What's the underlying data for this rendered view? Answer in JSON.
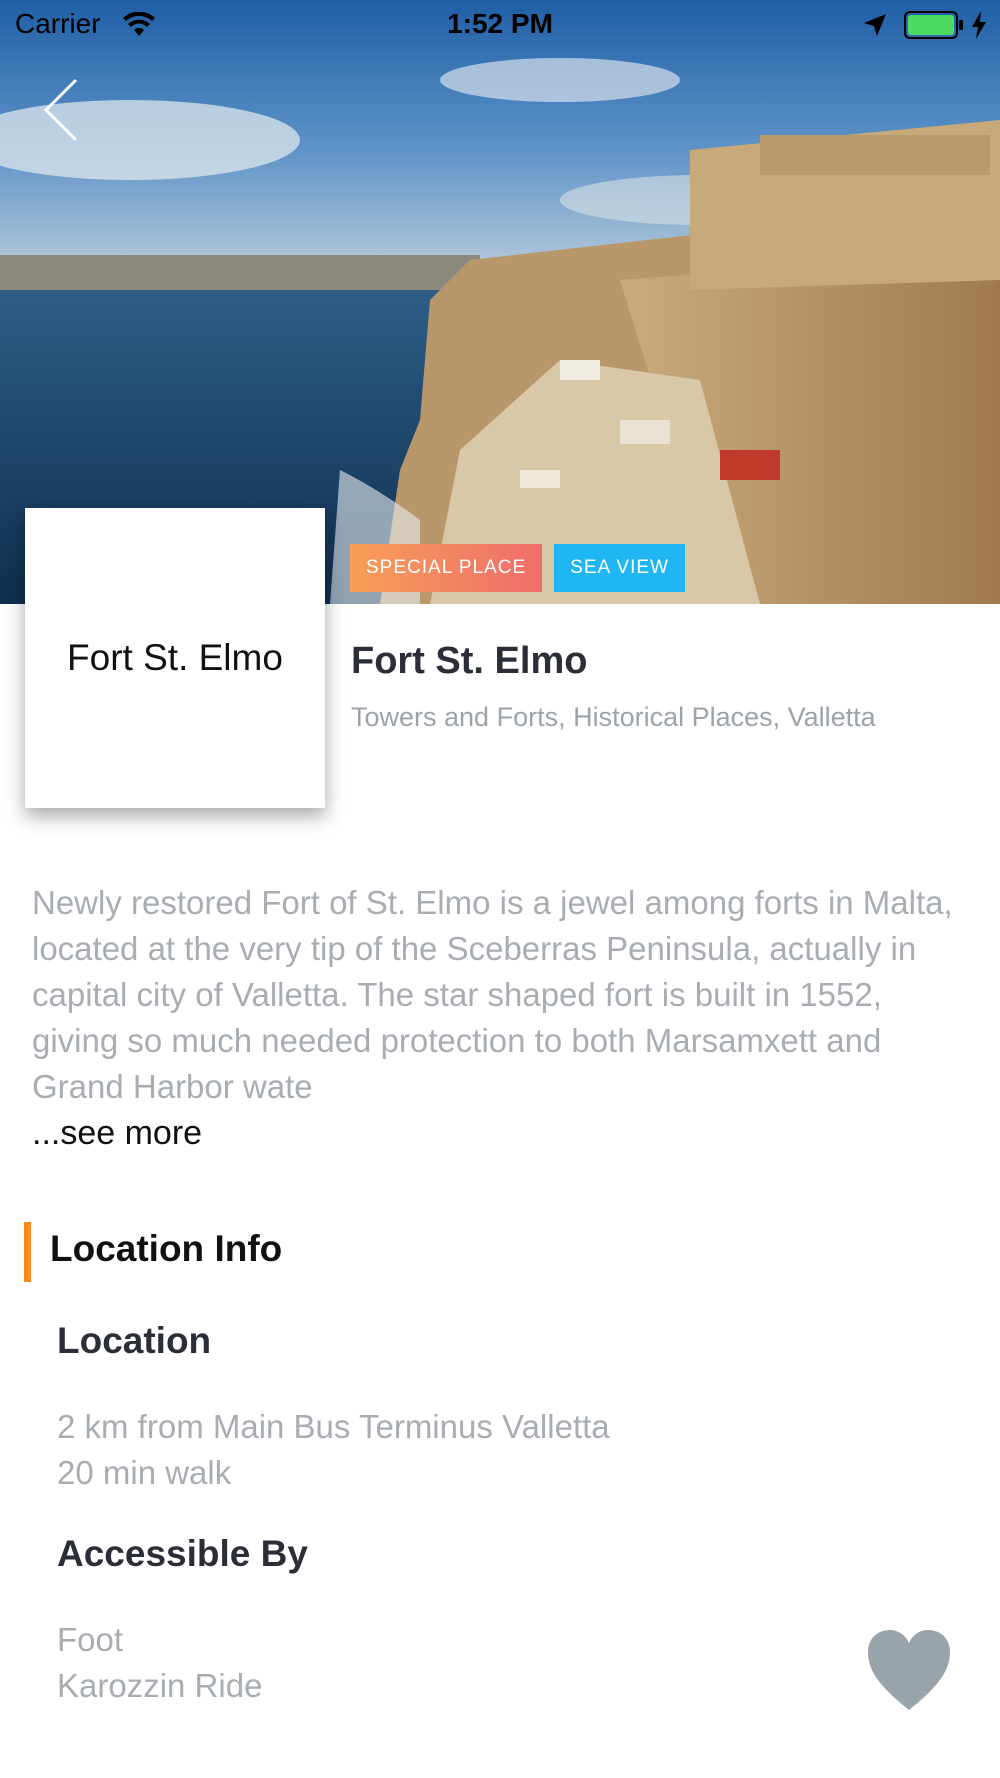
{
  "status_bar": {
    "carrier": "Carrier",
    "time": "1:52 PM"
  },
  "place": {
    "thumbnail_label": "Fort St. Elmo",
    "title": "Fort St. Elmo",
    "categories": "Towers and Forts, Historical Places, Valletta",
    "tags": [
      "SPECIAL PLACE",
      "SEA VIEW"
    ],
    "description": "Newly restored Fort of St. Elmo is a jewel among forts in Malta, located at the very tip of the Sceberras Peninsula, actually in capital city of Valletta. The star shaped fort is built in 1552, giving so much needed protection to both Marsamxett and Grand Harbor wate",
    "see_more": "...see more"
  },
  "location_info": {
    "section_title": "Location Info",
    "location_heading": "Location",
    "location_lines": [
      "2 km from Main Bus Terminus Valletta",
      "20 min walk"
    ],
    "accessible_heading": "Accessible By",
    "accessible_lines": [
      "Foot",
      "Karozzin Ride"
    ]
  },
  "icons": {
    "back": "chevron-left-icon",
    "wifi": "wifi-icon",
    "location": "location-arrow-icon",
    "battery": "battery-icon",
    "charging": "bolt-icon",
    "favorite": "heart-icon"
  },
  "colors": {
    "accent": "#ff8a1d",
    "tag_special": "#f79e58",
    "tag_sea": "#20b6f3",
    "heart": "#98a4aa",
    "battery": "#4cd964"
  }
}
